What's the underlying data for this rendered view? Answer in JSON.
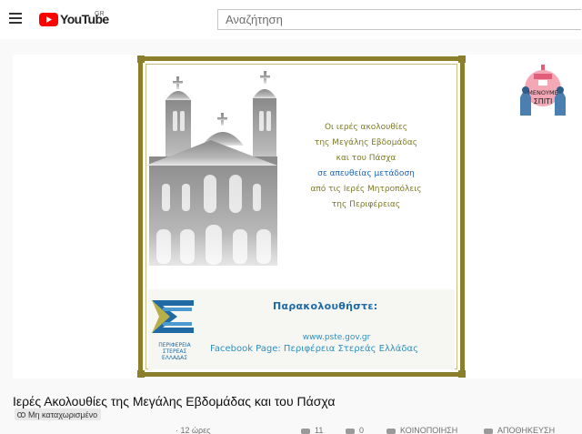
{
  "header": {
    "logo_text": "YouTube",
    "country_code": "GR",
    "search_placeholder": "Αναζήτηση"
  },
  "video": {
    "promo_lines": [
      "Οι ιερές ακολουθίες",
      "της Μεγάλης Εβδομάδας",
      "και του Πάσχα",
      "σε απευθείας μετάδοση",
      "από τις Ιερές Μητροπόλεις",
      "της Περιφέρειας"
    ],
    "watch_label": "Παρακολουθήστε:",
    "website": "www.pste.gov.gr",
    "facebook": "Facebook Page: Περιφέρεια Στερεάς Ελλάδας",
    "region_logo_text": [
      "ΠΕΡΙΦΕΡΕΙΑ",
      "ΣΤΕΡΕΑΣ",
      "ΕΛΛΑΔΑΣ"
    ],
    "badge_text": [
      "ΜΕΝΟΥΜΕ",
      "ΣΠΙΤΙ"
    ]
  },
  "info": {
    "title": "Ιερές Ακολουθίες της Μεγάλης Εβδομάδας και του Πάσχα",
    "privacy_label": "Μη καταχωρισμένο",
    "views_partial": "· 12 ώρες",
    "likes_partial": "11",
    "dislikes_partial": "0",
    "share_partial": "ΚΟΙΝΟΠΟΙΗΣΗ",
    "save_partial": "ΑΠΟΘΗΚΕΥΣΗ"
  },
  "colors": {
    "brand_red": "#ff0000",
    "frame_gold": "#8c7f2c",
    "promo_olive": "#7d7a24",
    "promo_blue": "#1d64b6",
    "region_blue": "#1f6aa5"
  }
}
